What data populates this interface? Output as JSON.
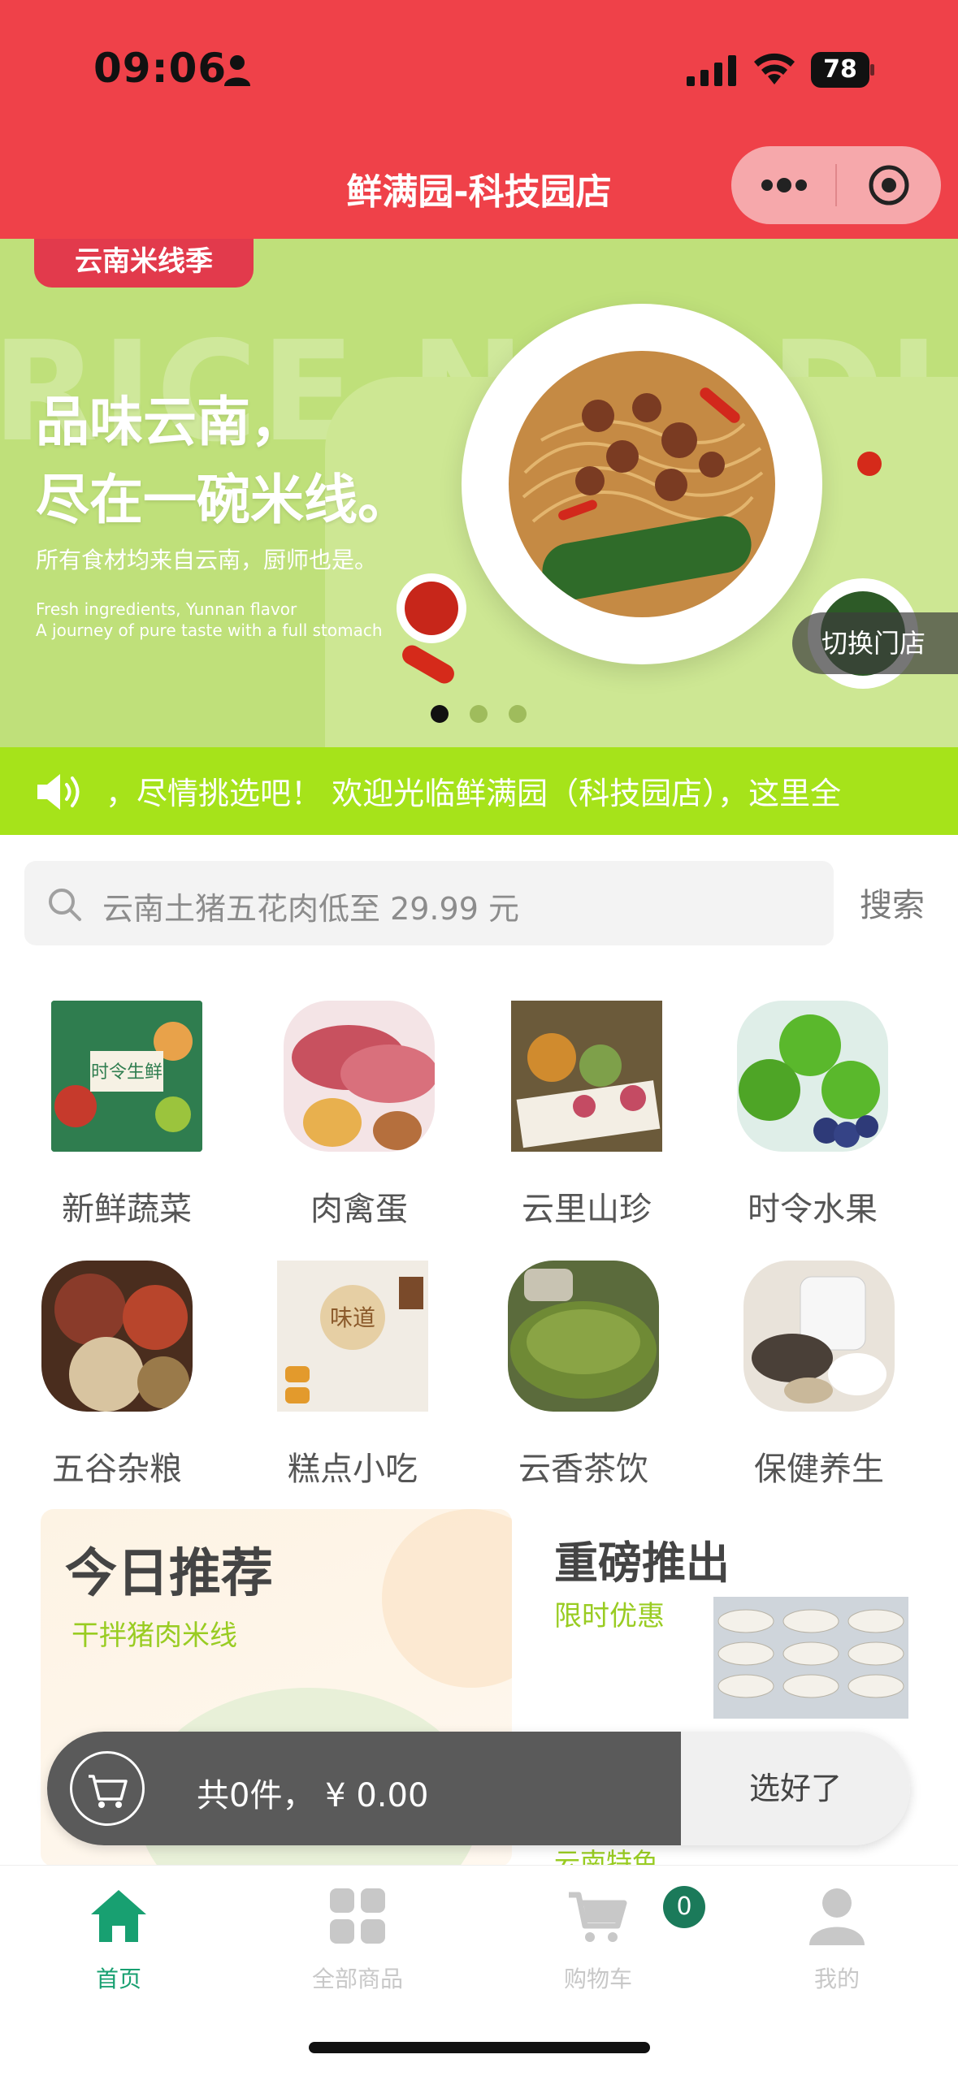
{
  "status_bar": {
    "time": "09:06",
    "battery": "78"
  },
  "header": {
    "title": "鲜满园-科技园店"
  },
  "banner": {
    "tag": "云南米线季",
    "bg_text": "RICE NOODLES",
    "headline_1": "品味云南，",
    "headline_2": "尽在一碗米线。",
    "subtitle": "所有食材均来自云南，厨师也是。",
    "english_1": "Fresh ingredients, Yunnan flavor",
    "english_2": "A journey of pure taste with a full stomach",
    "switch_store": "切换门店",
    "page_count": 3,
    "active_page": 1
  },
  "notice": {
    "text": "，尽情挑选吧！   欢迎光临鲜满园（科技园店），这里全"
  },
  "search": {
    "placeholder": "云南土猪五花肉低至 29.99 元",
    "button": "搜索"
  },
  "categories": [
    {
      "label": "新鲜蔬菜",
      "icon": "vegetables-image"
    },
    {
      "label": "肉禽蛋",
      "icon": "meat-image"
    },
    {
      "label": "云里山珍",
      "icon": "mushroom-image"
    },
    {
      "label": "时令水果",
      "icon": "fruit-image"
    },
    {
      "label": "五谷杂粮",
      "icon": "grains-image"
    },
    {
      "label": "糕点小吃",
      "icon": "pastry-image"
    },
    {
      "label": "云香茶饮",
      "icon": "tea-image"
    },
    {
      "label": "保健养生",
      "icon": "health-image"
    }
  ],
  "recommend": {
    "title": "今日推荐",
    "subtitle": "干拌猪肉米线"
  },
  "hot": {
    "title": "重磅推出",
    "subtitle": "限时优惠",
    "subtitle_2": "云南特色"
  },
  "cart_bar": {
    "summary": "共0件，   ¥ 0.00",
    "confirm": "选好了"
  },
  "tabbar": {
    "items": [
      {
        "label": "首页",
        "icon": "home-icon",
        "active": true
      },
      {
        "label": "全部商品",
        "icon": "grid-icon",
        "active": false
      },
      {
        "label": "购物车",
        "icon": "cart-icon",
        "active": false
      },
      {
        "label": "我的",
        "icon": "user-icon",
        "active": false
      }
    ],
    "cart_badge": "0"
  },
  "colors": {
    "header": "#ef4149",
    "notice": "#a6e31a",
    "accent_green": "#99cc22",
    "tab_active": "#18a071"
  }
}
